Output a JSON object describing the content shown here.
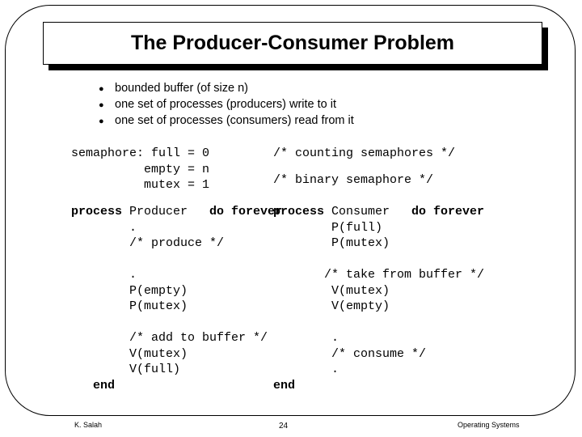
{
  "slide": {
    "title": "The Producer-Consumer Problem",
    "bullet_marker": "●",
    "bullets": [
      "bounded buffer (of size n)",
      "one set of processes (producers) write to it",
      "one set of processes (consumers) read from it"
    ],
    "semaphores": {
      "declaration": "semaphore: full = 0\n          empty = n\n          mutex = 1",
      "comment_counting": "/* counting semaphores */",
      "comment_binary": "/* binary semaphore */"
    },
    "producer": {
      "keyword_process": "process",
      "name": " Producer",
      "keyword_do_forever": "   do forever",
      "body": "\n        .\n        /* produce */\n\n        .\n        P(empty)\n        P(mutex)\n\n        /* add to buffer */\n        V(mutex)\n        V(full)\n   ",
      "keyword_end": "end"
    },
    "consumer": {
      "keyword_process": "process",
      "name": " Consumer",
      "keyword_do_forever": "   do forever",
      "body": "\n        P(full)\n        P(mutex)\n\n       /* take from buffer */\n        V(mutex)\n        V(empty)\n\n        .\n        /* consume */\n        .\n",
      "keyword_end": "end"
    },
    "footer": {
      "author": "K. Salah",
      "page_number": "24",
      "course": "Operating Systems"
    },
    "colors": {
      "background": "#ffffff",
      "foreground": "#000000"
    }
  }
}
